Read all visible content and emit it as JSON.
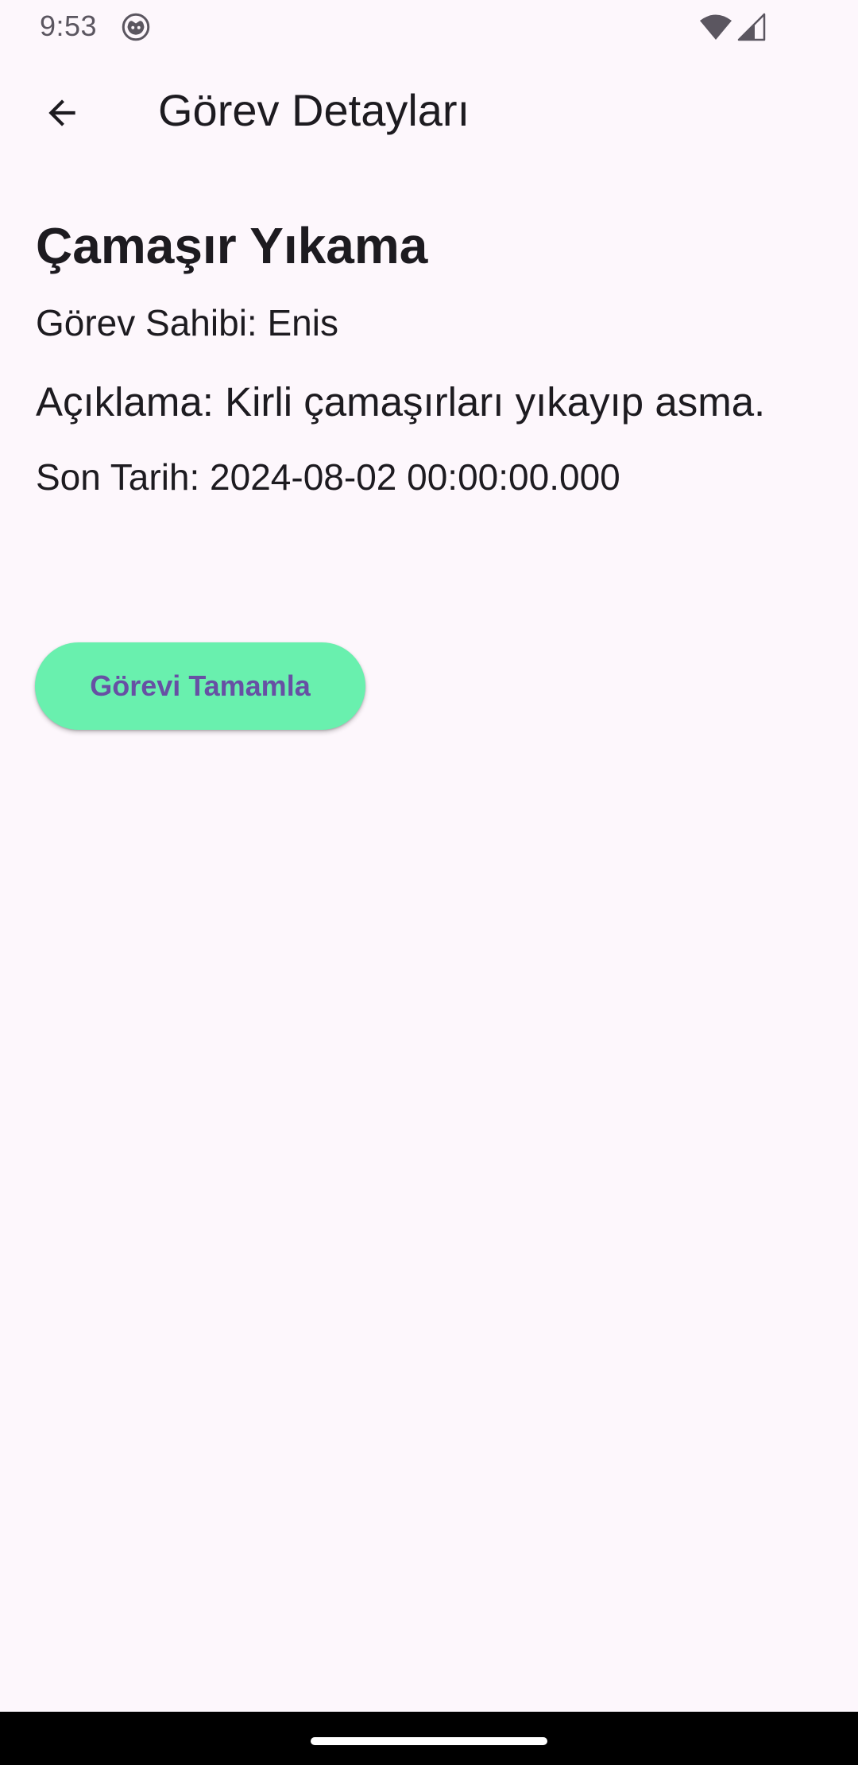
{
  "status_bar": {
    "time": "9:53",
    "icons": [
      "app-notification-icon",
      "wifi-icon",
      "cellular-signal-icon"
    ]
  },
  "app_bar": {
    "back_icon": "arrow-back-icon",
    "title": "Görev Detayları"
  },
  "task": {
    "title": "Çamaşır Yıkama",
    "owner": "Görev Sahibi: Enis",
    "description": "Açıklama: Kirli çamaşırları yıkayıp asma.",
    "deadline": "Son Tarih: 2024-08-02 00:00:00.000"
  },
  "actions": {
    "complete_label": "Görevi Tamamla"
  },
  "colors": {
    "background": "#FDF7FC",
    "button_bg": "#69F0AE",
    "button_text": "#6750A4",
    "text": "#1D1B20"
  }
}
